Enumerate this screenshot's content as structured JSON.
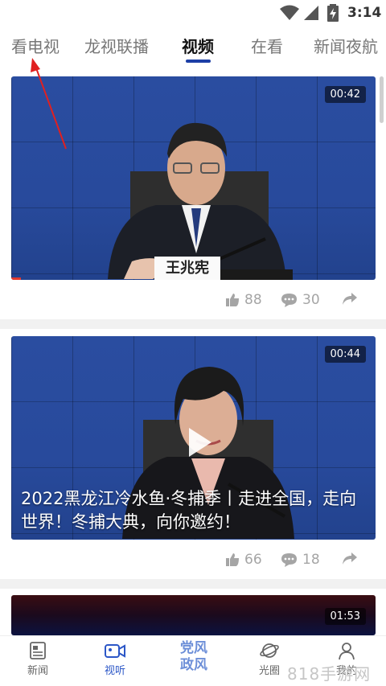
{
  "status_bar": {
    "time": "3:14"
  },
  "tabs": [
    {
      "label": "看电视"
    },
    {
      "label": "龙视联播"
    },
    {
      "label": "视频"
    },
    {
      "label": "在看"
    },
    {
      "label": "新闻夜航"
    }
  ],
  "active_tab": "视频",
  "cards": [
    {
      "duration": "00:42",
      "nameplate": "王兆宪",
      "likes": "88",
      "comments": "30",
      "title": ""
    },
    {
      "duration": "00:44",
      "likes": "66",
      "comments": "18",
      "title": "2022黑龙江冷水鱼·冬捕季丨走进全国，走向世界！冬捕大典，向你邀约！"
    },
    {
      "duration": "01:53"
    }
  ],
  "bottom_nav": [
    {
      "label": "新闻",
      "icon": "news-icon"
    },
    {
      "label": "视听",
      "icon": "video-camera-icon"
    },
    {
      "label": "党风政风",
      "lines": [
        "党风",
        "政风"
      ]
    },
    {
      "label": "光圈",
      "icon": "planet-icon"
    },
    {
      "label": "我的",
      "icon": "person-icon"
    }
  ],
  "watermark": "818手游网",
  "colors": {
    "accent": "#2c57c7",
    "tab_underline": "#1d3fa6",
    "annotation": "#e02020"
  }
}
